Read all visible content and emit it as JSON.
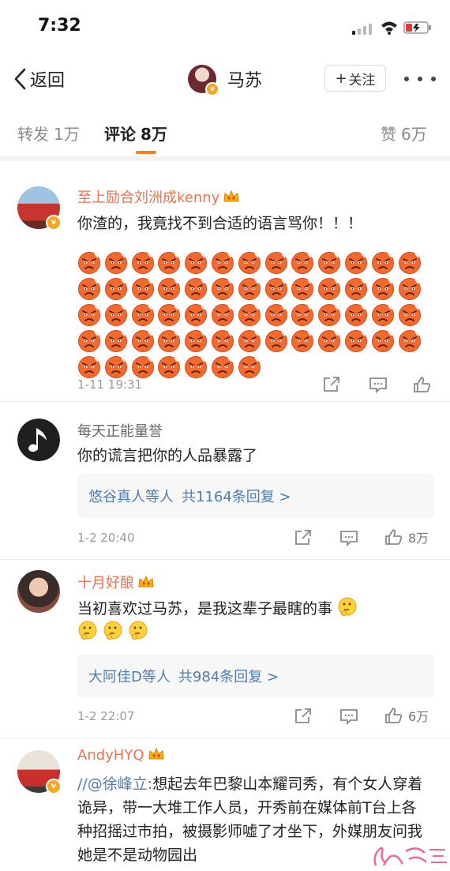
{
  "status_bar": {
    "time": "7:32"
  },
  "nav": {
    "back_label": "返回",
    "title": "马苏",
    "follow_label": "关注"
  },
  "tabs": [
    {
      "label": "转发",
      "count": "1万"
    },
    {
      "label": "评论",
      "count": "8万",
      "active": true
    },
    {
      "label": "赞",
      "count": "6万"
    }
  ],
  "comments": [
    {
      "author": "至上励合刘洲成kenny",
      "text": "你渣的，我竟找不到合适的语言骂你！！！",
      "emoji_count": 59,
      "time": "1-11 19:31"
    },
    {
      "author": "每天正能量誉",
      "text": "你的谎言把你的人品暴露了",
      "reply_users": "悠谷真人等人",
      "reply_total": "共1164条回复 >",
      "time": "1-2 20:40",
      "likes": "8万"
    },
    {
      "author": "十月好酿",
      "text": "当初喜欢过马苏，是我这辈子最瞎的事",
      "reply_users": "大阿佳D等人",
      "reply_total": "共984条回复 >",
      "time": "1-2 22:07",
      "likes": "6万"
    },
    {
      "author": "AndyHYQ",
      "mention": "//@徐峰立:",
      "text": "想起去年巴黎山本耀司秀，有个女人穿着诡异，带一大堆工作人员，开秀前在媒体前T台上各种招摇过市拍，被摄影师嘘了才坐下，外媒朋友问我她是不是动物园出"
    }
  ],
  "colors": {
    "name_orange": "#eb7350",
    "link_blue": "#507daf",
    "accent": "#f48221",
    "time_gray": "#9b9b9b"
  },
  "icons": [
    "back-chevron-icon",
    "signal-icon",
    "wifi-icon",
    "battery-icon",
    "more-dots-icon",
    "share-icon",
    "comment-icon",
    "like-icon",
    "crown-icon",
    "angry-emoji",
    "thinking-emoji"
  ]
}
